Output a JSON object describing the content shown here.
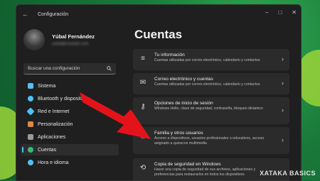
{
  "window": {
    "title": "Configuración",
    "back_symbol": "←",
    "controls": [
      "–",
      "□",
      "✕"
    ]
  },
  "profile": {
    "name": "Yúbal Fernández",
    "email": "yubal@example.com"
  },
  "search": {
    "placeholder": "Buscar una configuración",
    "icon": "search-icon"
  },
  "sidebar": {
    "items": [
      {
        "label": "Sistema",
        "icon": "monitor-icon",
        "color": "#4cc2ff",
        "active": false
      },
      {
        "label": "Bluetooth y dispositivos",
        "icon": "bluetooth-icon",
        "color": "#4cc2ff",
        "active": false
      },
      {
        "label": "Red e Internet",
        "icon": "network-icon",
        "color": "#4cc2ff",
        "active": false
      },
      {
        "label": "Personalización",
        "icon": "brush-icon",
        "color": "#e08a3b",
        "active": false
      },
      {
        "label": "Aplicaciones",
        "icon": "apps-icon",
        "color": "#9a9a9a",
        "active": false
      },
      {
        "label": "Cuentas",
        "icon": "user-icon",
        "color": "#2fbf71",
        "active": true
      },
      {
        "label": "Hora e idioma",
        "icon": "globe-icon",
        "color": "#4cc2ff",
        "active": false
      }
    ]
  },
  "main": {
    "title": "Cuentas",
    "cards": [
      {
        "title": "Tu información",
        "desc": "Cuentas utilizadas por correo electrónico, calendario y contactos",
        "icon": "user-card-icon"
      },
      {
        "title": "Correo electrónico y cuentas",
        "desc": "Cuentas utilizadas por correo electrónico, calendario y contactos",
        "icon": "mail-icon"
      },
      {
        "title": "Opciones de inicio de sesión",
        "desc": "Windows Hello, clave de seguridad, contraseña, bloqueo dinámico",
        "icon": "key-icon"
      },
      {
        "title": "Familia y otros usuarios",
        "desc": "Acceso a dispositivos, usuarios profesionales o educativos, acceso asignado a quioscos multimedia",
        "icon": "family-icon"
      },
      {
        "title": "Copia de seguridad en Windows",
        "desc": "Hacer una copia de seguridad de sus archivos, aplicaciones y preferencias para restaurarlos en todos los dispositivos",
        "icon": "backup-icon"
      }
    ]
  },
  "watermark": "XATAKA BASICS"
}
